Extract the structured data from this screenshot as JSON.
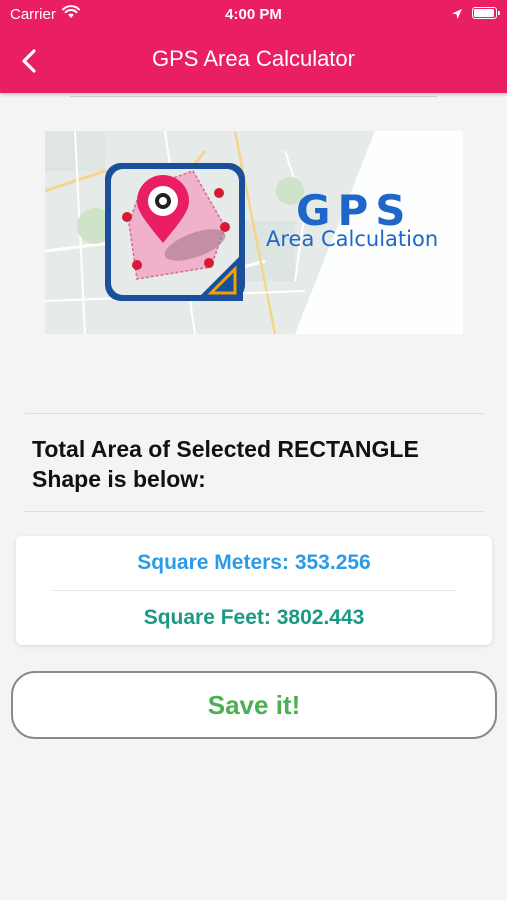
{
  "status_bar": {
    "carrier": "Carrier",
    "time": "4:00 PM",
    "battery_level": 1.0,
    "icons": [
      "wifi-icon",
      "location-arrow-icon",
      "battery-icon"
    ]
  },
  "header": {
    "title": "GPS Area Calculator",
    "back_icon": "chevron-left-icon",
    "background": "#e91e63"
  },
  "banner": {
    "heading": "GPS",
    "subheading": "Area  Calculation",
    "accent": "#1e67c9"
  },
  "result": {
    "heading": "Total Area of Selected RECTANGLE Shape is below:",
    "square_meters": "Square Meters: 353.256",
    "square_feet": "Square Feet: 3802.443",
    "meters_color": "#2b9be6",
    "feet_color": "#1a9a84"
  },
  "actions": {
    "save_label": "Save it!",
    "save_color": "#4caf50"
  }
}
